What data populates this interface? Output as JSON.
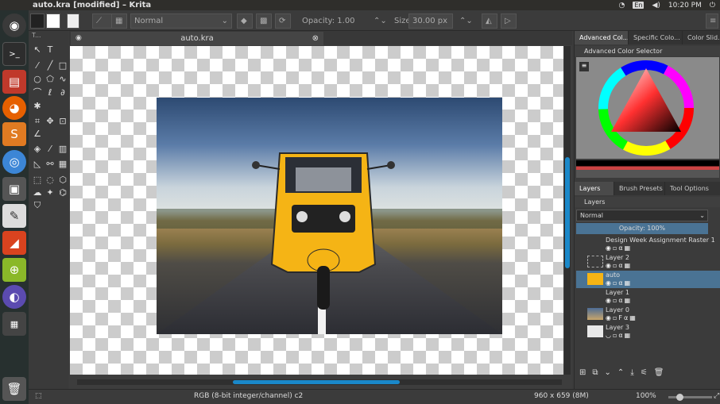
{
  "topbar": {
    "title": "auto.kra [modified] – Krita",
    "lang": "En",
    "time": "10:20 PM"
  },
  "toolbar": {
    "blend_mode": "Normal",
    "opacity_label": "Opacity: 1.00",
    "size_label": "Size:",
    "size_value": "30.00 px"
  },
  "toolbox": {
    "header": "T..."
  },
  "canvas": {
    "tab_title": "auto.kra"
  },
  "dock": {
    "tabs": [
      "Advanced Col...",
      "Specific Colo...",
      "Color Slid..."
    ],
    "color_selector_title": "Advanced Color Selector",
    "layer_tabs": [
      "Layers",
      "Brush Presets",
      "Tool Options"
    ],
    "layers_title": "Layers",
    "blend_mode": "Normal",
    "opacity": "Opacity:  100%",
    "layers": [
      {
        "name": "Design Week  Assignment Raster 1",
        "selected": false
      },
      {
        "name": "Layer 2",
        "selected": false
      },
      {
        "name": "auto",
        "selected": true
      },
      {
        "name": "Layer 1",
        "selected": false
      },
      {
        "name": "Layer 0",
        "selected": false
      },
      {
        "name": "Layer 3",
        "selected": false
      }
    ]
  },
  "status": {
    "color_model": "RGB (8-bit integer/channel)  c2",
    "image_size": "960 x 659 (8M)",
    "zoom": "100%"
  },
  "colors": {
    "accent": "#1a88c9",
    "selected_layer": "#4a7394"
  }
}
